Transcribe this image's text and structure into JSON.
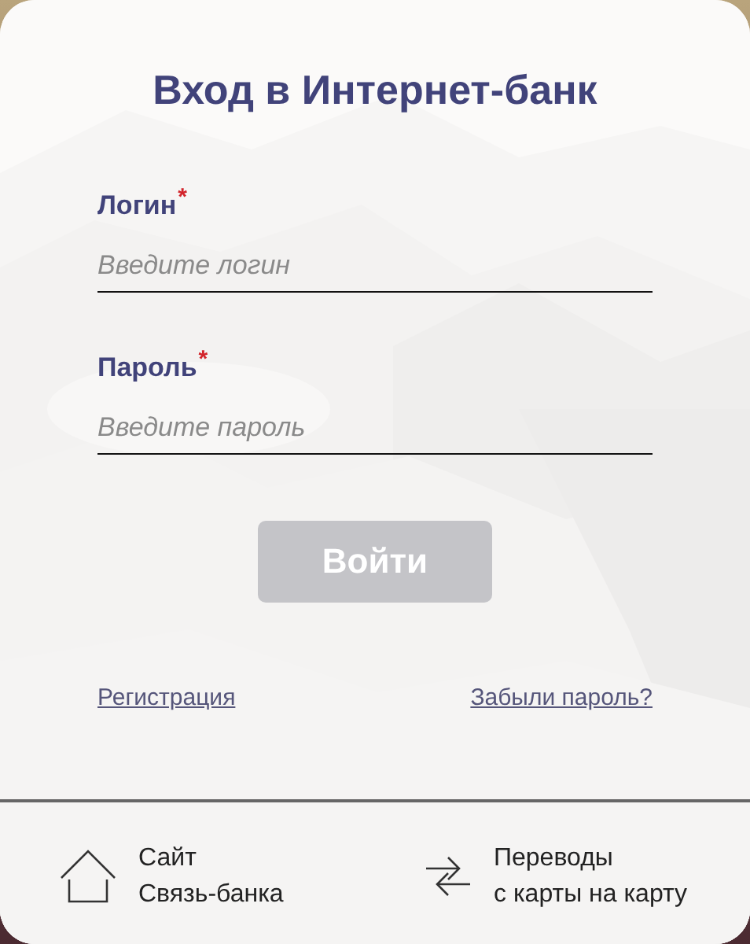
{
  "title": "Вход в Интернет-банк",
  "fields": [
    {
      "label": "Логин",
      "required_mark": "*",
      "placeholder": "Введите логин"
    },
    {
      "label": "Пароль",
      "required_mark": "*",
      "placeholder": "Введите пароль"
    }
  ],
  "submit": {
    "label": "Войти",
    "disabled": true
  },
  "links": [
    "Регистрация",
    "Забыли пароль?"
  ],
  "footer": [
    {
      "kind": "home",
      "lines": [
        "Сайт",
        "Связь-банка"
      ]
    },
    {
      "kind": "transfer",
      "lines": [
        "Переводы",
        "с карты на карту"
      ]
    }
  ]
}
